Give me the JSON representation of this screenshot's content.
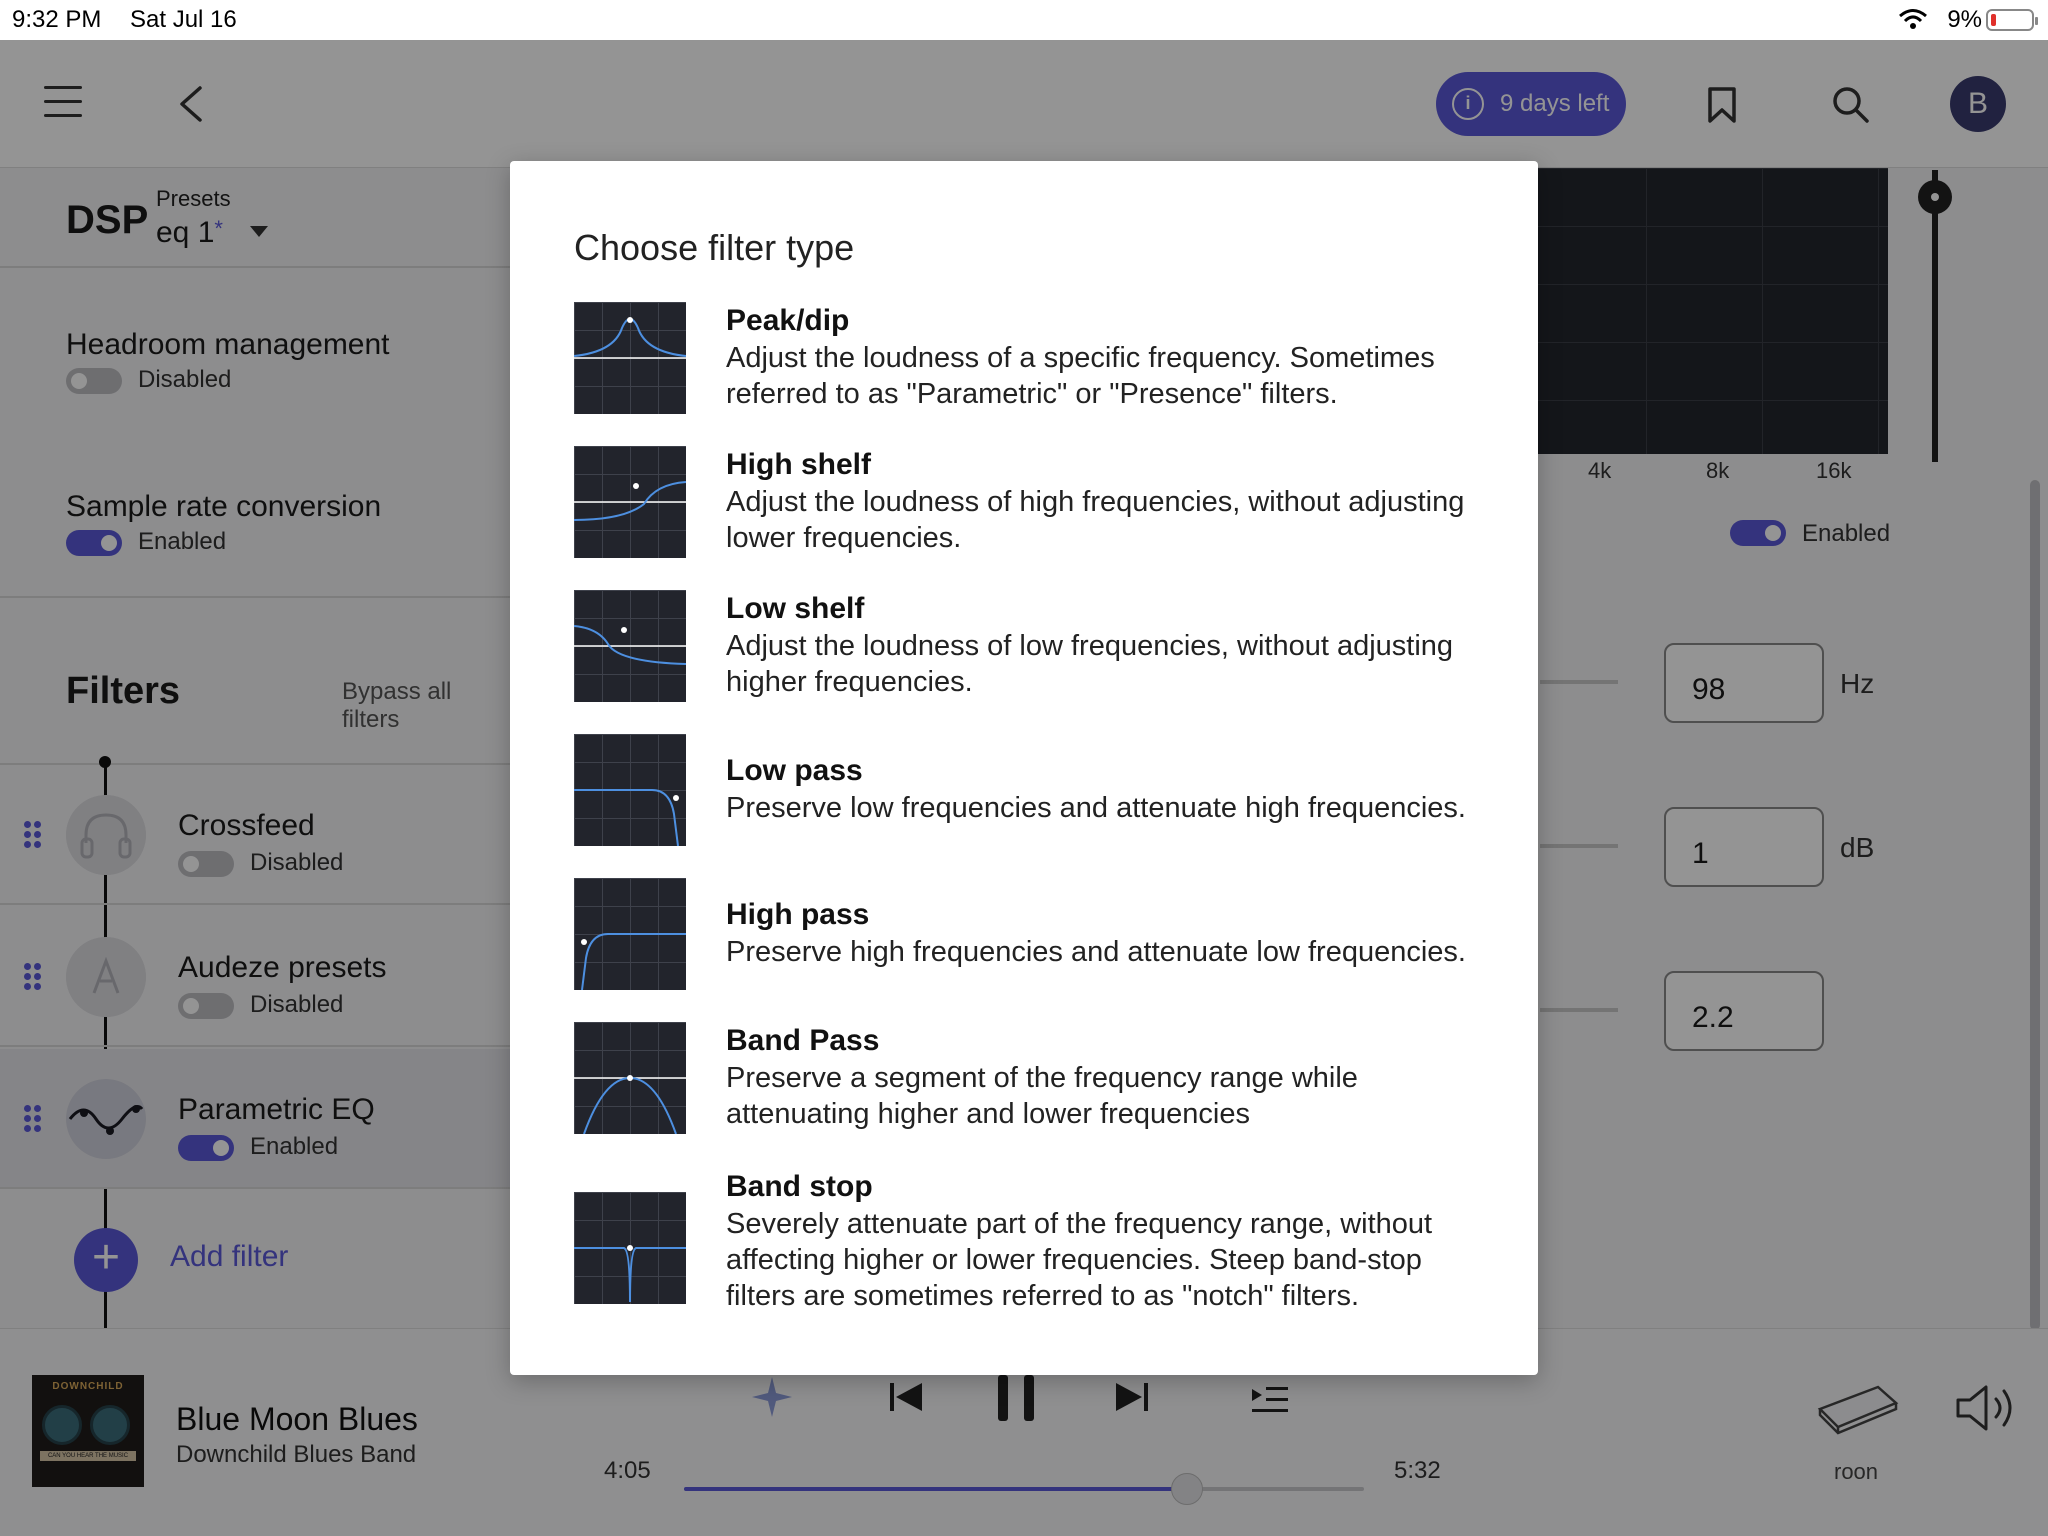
{
  "status_bar": {
    "time": "9:32 PM",
    "date": "Sat Jul 16",
    "battery": "9%"
  },
  "header": {
    "trial_label": "9 days left",
    "avatar_initial": "B"
  },
  "dsp": {
    "title": "DSP",
    "presets_label": "Presets",
    "preset_name": "eq 1",
    "preset_modified_mark": "*"
  },
  "settings": [
    {
      "title": "Headroom management",
      "state": "Disabled",
      "enabled": false
    },
    {
      "title": "Sample rate conversion",
      "state": "Enabled",
      "enabled": true
    }
  ],
  "filters": {
    "title": "Filters",
    "bypass_label": "Bypass all filters",
    "items": [
      {
        "name": "Crossfeed",
        "state": "Disabled",
        "enabled": false,
        "icon": "headphones-icon"
      },
      {
        "name": "Audeze presets",
        "state": "Disabled",
        "enabled": false,
        "icon": "audeze-logo-icon"
      },
      {
        "name": "Parametric EQ",
        "state": "Enabled",
        "enabled": true,
        "icon": "eq-curve-icon"
      }
    ],
    "add_label": "Add filter"
  },
  "eq_panel": {
    "freq_ticks": [
      "4k",
      "8k",
      "16k"
    ],
    "enabled_label": "Enabled",
    "params": [
      {
        "value": "98",
        "unit": "Hz"
      },
      {
        "value": "1",
        "unit": "dB"
      },
      {
        "value": "2.2",
        "unit": ""
      }
    ]
  },
  "now_playing": {
    "title": "Blue Moon Blues",
    "artist": "Downchild Blues Band",
    "elapsed": "4:05",
    "total": "5:32",
    "progress": 0.74,
    "zone": "roon",
    "album_art_text": "DOWNCHILD",
    "album_art_subtext": "CAN YOU HEAR THE MUSIC"
  },
  "dialog": {
    "title": "Choose filter type",
    "options": [
      {
        "name": "Peak/dip",
        "description": "Adjust the loudness of a specific frequency. Sometimes referred to as \"Parametric\" or \"Presence\" filters.",
        "icon": "peak-dip-icon"
      },
      {
        "name": "High shelf",
        "description": "Adjust the loudness of high frequencies, without adjusting lower frequencies.",
        "icon": "high-shelf-icon"
      },
      {
        "name": "Low shelf",
        "description": "Adjust the loudness of low frequencies, without adjusting higher frequencies.",
        "icon": "low-shelf-icon"
      },
      {
        "name": "Low pass",
        "description": "Preserve low frequencies and attenuate high frequencies.",
        "icon": "low-pass-icon"
      },
      {
        "name": "High pass",
        "description": "Preserve high frequencies and attenuate low frequencies.",
        "icon": "high-pass-icon"
      },
      {
        "name": "Band Pass",
        "description": "Preserve a segment of the frequency range while attenuating higher and lower frequencies",
        "icon": "band-pass-icon"
      },
      {
        "name": "Band stop",
        "description": "Severely attenuate part of the frequency range, without affecting higher or lower frequencies. Steep band-stop filters are sometimes referred to as \"notch\" filters.",
        "icon": "band-stop-icon"
      }
    ]
  },
  "colors": {
    "accent": "#5a58d8",
    "graph_bg": "#24262e",
    "curve": "#4d8fe0"
  }
}
